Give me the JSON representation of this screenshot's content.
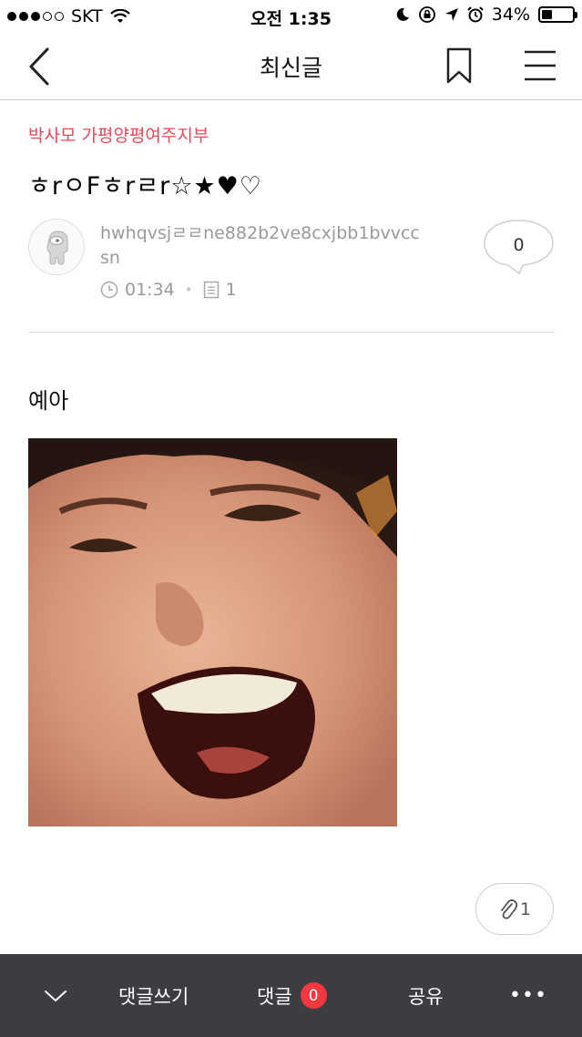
{
  "status_bar": {
    "carrier": "SKT",
    "time": "오전 1:35",
    "battery": "34%",
    "battery_level": 0.34
  },
  "nav": {
    "title": "최신글"
  },
  "post": {
    "board": "박사모 가평양평여주지부",
    "title": "ㅎrㅇFㅎrㄹr☆★♥♡",
    "author": "hwhqvsjㄹㄹne882b2ve8cxjbb1bvvccsn",
    "time": "01:34",
    "view_count": "1",
    "comment_count": "0",
    "body": "예아",
    "attachment_count": "1"
  },
  "bottom_bar": {
    "write_label": "댓글쓰기",
    "comments_label": "댓글",
    "comments_count": "0",
    "share_label": "공유",
    "more_label": "•••"
  },
  "colors": {
    "accent": "#e8495a",
    "badge": "#f0383e",
    "bottom_bar_bg": "#3d3d41",
    "meta_text": "#9a9a9a"
  },
  "icons": [
    "wifi-icon",
    "moon-icon",
    "rotation-lock-icon",
    "location-arrow-icon",
    "alarm-icon",
    "battery-icon",
    "back-chevron-icon",
    "bookmark-icon",
    "hamburger-menu-icon",
    "clock-icon",
    "document-icon",
    "speech-bubble-icon",
    "paperclip-icon",
    "chevron-down-icon",
    "more-dots-icon"
  ]
}
